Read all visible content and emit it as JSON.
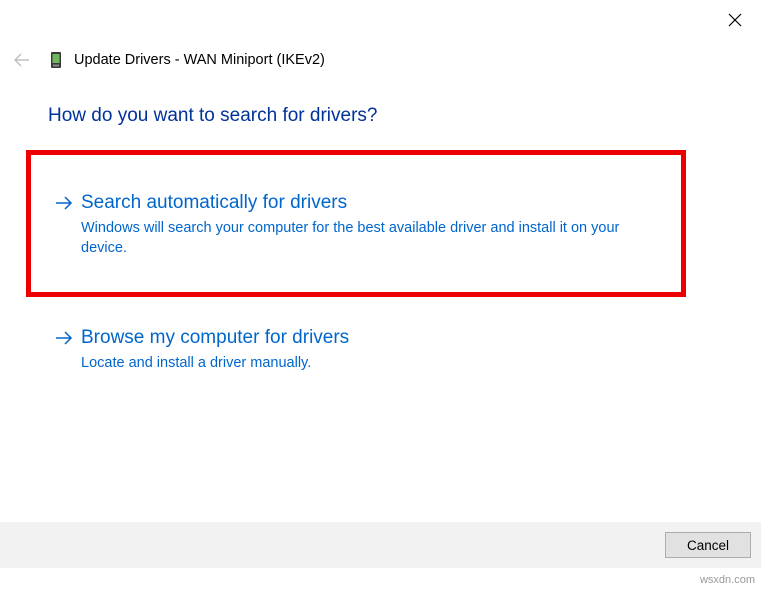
{
  "window": {
    "title": "Update Drivers - WAN Miniport (IKEv2)"
  },
  "heading": "How do you want to search for drivers?",
  "options": {
    "auto": {
      "title": "Search automatically for drivers",
      "desc": "Windows will search your computer for the best available driver and install it on your device."
    },
    "browse": {
      "title": "Browse my computer for drivers",
      "desc": "Locate and install a driver manually."
    }
  },
  "buttons": {
    "cancel": "Cancel"
  },
  "watermark": "wsxdn.com"
}
